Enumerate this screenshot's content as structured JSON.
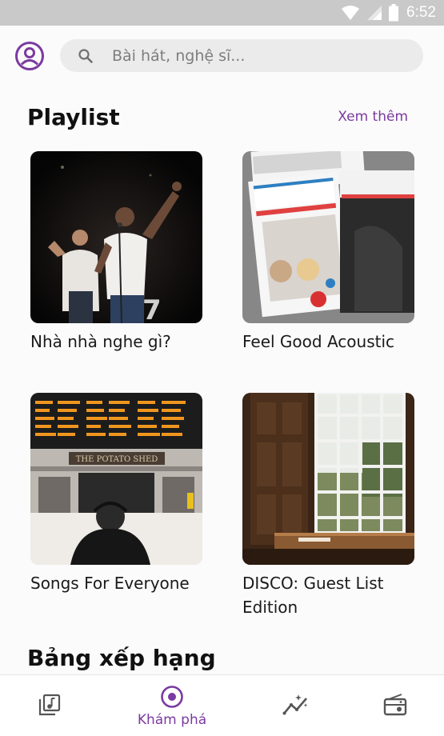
{
  "status_bar": {
    "time": "6:52",
    "icons": [
      "wifi-icon",
      "cell-signal-icon",
      "battery-icon"
    ]
  },
  "search": {
    "placeholder": "Bài hát, nghệ sĩ...",
    "value": ""
  },
  "playlist_section": {
    "title": "Playlist",
    "see_more": "Xem thêm",
    "items": [
      {
        "title": "Nhà nhà nghe gì?"
      },
      {
        "title": "Feel Good Acoustic"
      },
      {
        "title": "Songs For Everyone"
      },
      {
        "title": "DISCO: Guest List Edition"
      }
    ]
  },
  "chart_section": {
    "title": "Bảng xếp hạng"
  },
  "bottom_nav": {
    "items": [
      {
        "icon": "music-library-icon",
        "label": "",
        "active": false
      },
      {
        "icon": "disc-icon",
        "label": "Khám phá",
        "active": true
      },
      {
        "icon": "trending-icon",
        "label": "",
        "active": false
      },
      {
        "icon": "radio-icon",
        "label": "",
        "active": false
      }
    ]
  },
  "colors": {
    "accent": "#7b3aa0",
    "status_bar": "#c9c9c9",
    "search_bg": "#ebebeb",
    "inactive_icon": "#555555"
  }
}
